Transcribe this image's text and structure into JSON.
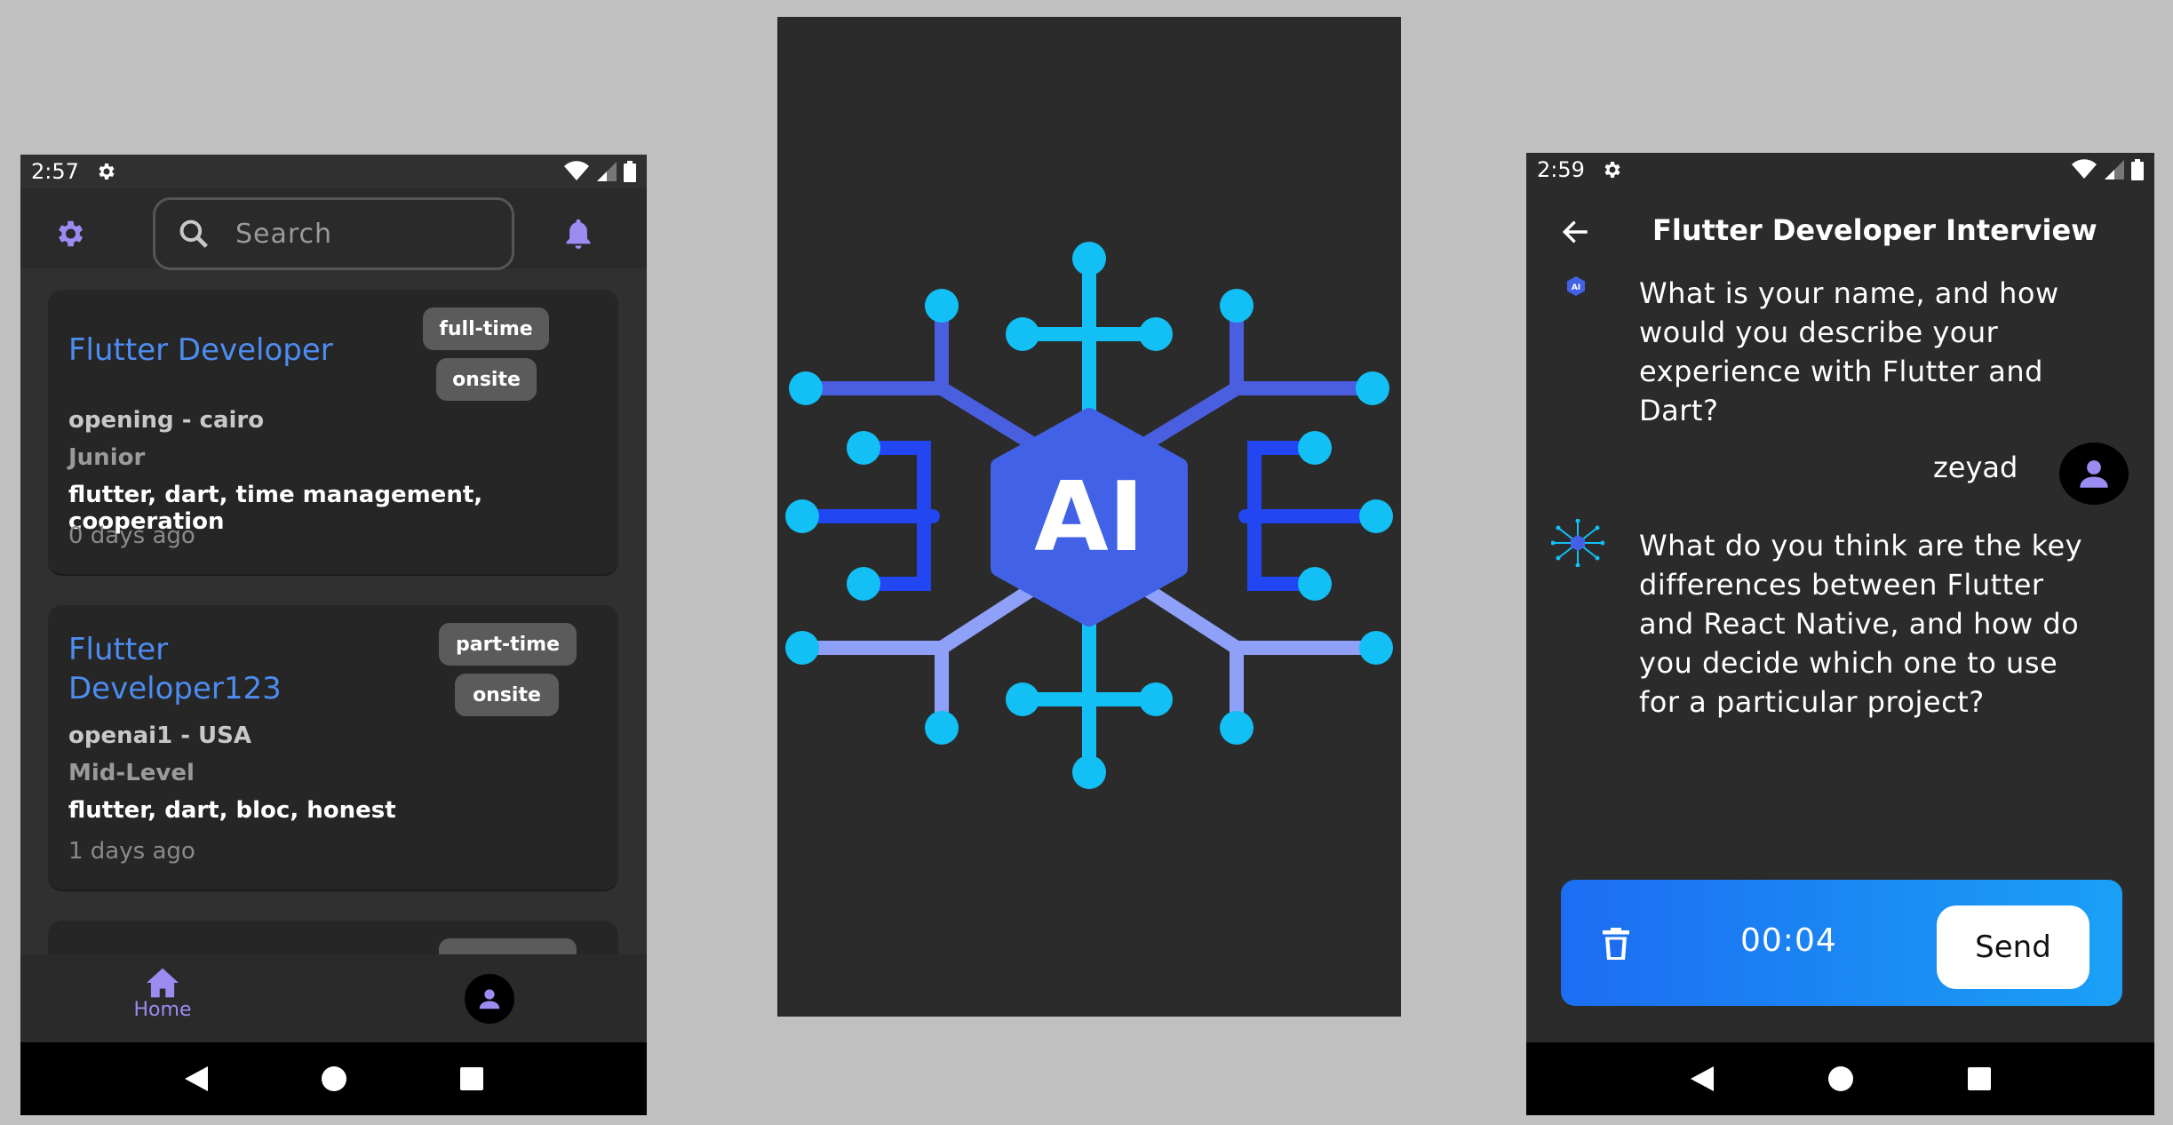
{
  "colors": {
    "background": "#c0c0c0",
    "accent_blue": "#4d8cf0",
    "accent_purple": "#9b8cf2",
    "chip_bg": "#5b5b5b",
    "recorder_start": "#1c6df2",
    "recorder_end": "#1aa0f6"
  },
  "home": {
    "status_time": "2:57",
    "search_placeholder": "Search",
    "jobs": [
      {
        "title": "Flutter Developer",
        "type": "full-time",
        "mode": "onsite",
        "location": "opening - cairo",
        "level": "Junior",
        "skills": "flutter, dart, time management, cooperation",
        "posted": "0 days ago"
      },
      {
        "title": "Flutter Developer123",
        "type": "part-time",
        "mode": "onsite",
        "location": "openai1 - USA",
        "level": "Mid-Level",
        "skills": "flutter, dart, bloc, honest",
        "posted": "1 days ago"
      }
    ],
    "nav": {
      "home_label": "Home"
    },
    "icons": [
      "settings-icon",
      "search-icon",
      "bell-icon",
      "home-icon",
      "profile-icon"
    ]
  },
  "splash": {
    "logo_text": "AI"
  },
  "interview": {
    "status_time": "2:59",
    "title": "Flutter Developer Interview",
    "messages": [
      {
        "sender": "ai",
        "text": "What is your name, and how would you describe your experience with Flutter and Dart?"
      },
      {
        "sender": "user",
        "text": "zeyad"
      },
      {
        "sender": "ai",
        "text": "What do you think are the key differences between Flutter and React Native, and how do you decide which one to use for a particular project?"
      }
    ],
    "recorder": {
      "timer": "00:04",
      "send_label": "Send"
    }
  }
}
